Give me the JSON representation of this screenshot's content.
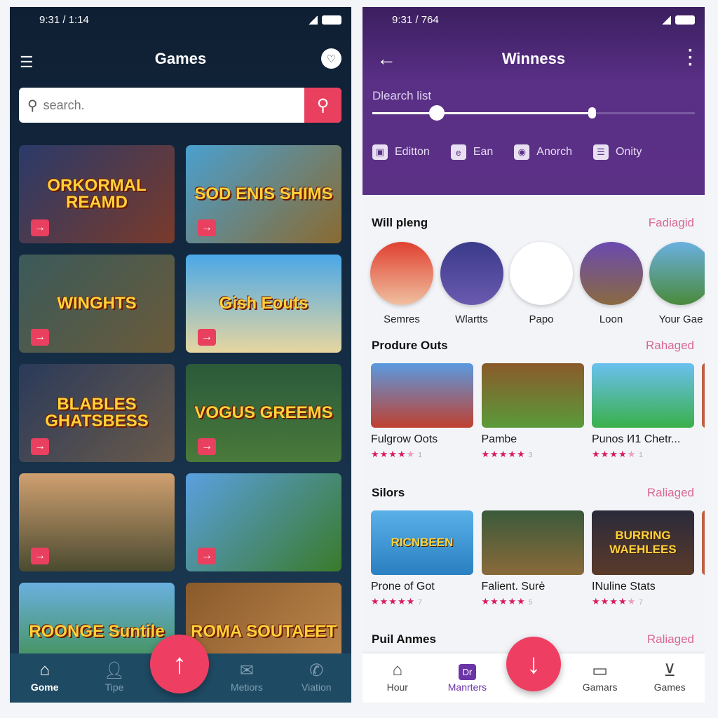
{
  "left": {
    "status_time": "9:31 / 1:14",
    "title": "Games",
    "search_placeholder": "search.",
    "tiles": [
      {
        "title": "ORKORMAL REAMD"
      },
      {
        "title": "SOD ENIS SHIMS"
      },
      {
        "title": "WINGHTS"
      },
      {
        "title": "Gish Eouts"
      },
      {
        "title": "BLABLES GHATSBESS"
      },
      {
        "title": "VOGUS GREEMS"
      },
      {
        "title": ""
      },
      {
        "title": ""
      },
      {
        "title": "ROONGE Suntile"
      },
      {
        "title": "ROMA SOUTAEET"
      }
    ],
    "nav": [
      {
        "label": "Gome",
        "icon": "home-icon",
        "active": true
      },
      {
        "label": "Tipe",
        "icon": "user-icon"
      },
      {
        "label": "Metiors",
        "icon": "mail-icon"
      },
      {
        "label": "Viation",
        "icon": "phone-icon"
      }
    ],
    "fab_icon": "arrow-up-icon",
    "accent": "#e9405f"
  },
  "right": {
    "status_time": "9:31 / 764",
    "title": "Winness",
    "slider_label": "Dlearch list",
    "slider_range": [
      0.2,
      0.68
    ],
    "chips": [
      {
        "label": "Editton",
        "icon": "briefcase-icon"
      },
      {
        "label": "Ean",
        "icon": "e-icon"
      },
      {
        "label": "Anorch",
        "icon": "location-icon"
      },
      {
        "label": "Onity",
        "icon": "list-icon"
      }
    ],
    "sections": [
      {
        "title": "Will pleng",
        "action": "Fadiagid",
        "avatars": [
          "Semres",
          "Wlartts",
          "Papo",
          "Loon",
          "Your Gae"
        ]
      },
      {
        "title": "Produre Outs",
        "action": "Rahaged",
        "cards": [
          {
            "name": "Fulgrow Oots",
            "rating": 4,
            "count": "1"
          },
          {
            "name": "Pambe",
            "rating": 5,
            "count": "3"
          },
          {
            "name": "Punos I⁄I1 Chetr...",
            "rating": 4,
            "count": "1"
          }
        ]
      },
      {
        "title": "Silors",
        "action": "Raliaged",
        "cards": [
          {
            "name": "Prone of Got",
            "rating": 5,
            "count": "7",
            "art": "RICNBEEN"
          },
          {
            "name": "Falient. Surė",
            "rating": 5,
            "count": "5"
          },
          {
            "name": "INuline Stats",
            "rating": 4,
            "count": "7",
            "art": "BURRING WAEHLEES"
          }
        ]
      },
      {
        "title": "Puil Anmes",
        "action": "Raliaged"
      }
    ],
    "nav": [
      {
        "label": "Hour",
        "icon": "home-icon"
      },
      {
        "label": "Manrters",
        "icon": "dr-badge-icon",
        "badge": "Dr",
        "active": true
      },
      {
        "label": "Gamars",
        "icon": "calendar-icon"
      },
      {
        "label": "Games",
        "icon": "download-icon"
      }
    ],
    "fab_icon": "arrow-down-icon",
    "purple": "#5b3186"
  }
}
